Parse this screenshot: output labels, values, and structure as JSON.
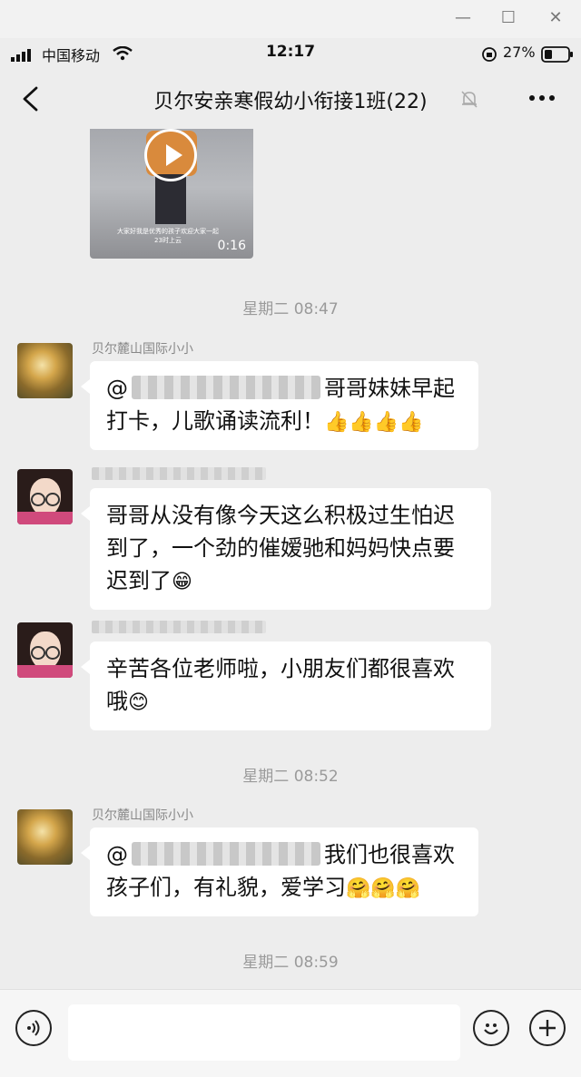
{
  "window": {
    "minimize": "—",
    "maximize": "☐",
    "close": "✕"
  },
  "status_bar": {
    "carrier": "中国移动",
    "time": "12:17",
    "battery": "27%"
  },
  "nav": {
    "title": "贝尔安亲寒假幼小衔接1班(22)"
  },
  "video": {
    "caption": "大家好我是优秀的孩子欢迎大家一起 23时上云",
    "duration": "0:16"
  },
  "timestamps": [
    "星期二 08:47",
    "星期二 08:52",
    "星期二 08:59"
  ],
  "messages": [
    {
      "sender": "贝尔麓山国际小小",
      "text_a": "@",
      "text_b": "哥哥妹妹早起",
      "text_c": "打卡，儿歌诵读流利！",
      "emoji": "👍👍👍👍"
    },
    {
      "sender": "",
      "text_a": "哥哥从没有像今天这么积极过生怕迟",
      "text_b": "到了，一个劲的催嫒驰和妈妈快点要",
      "text_c": "迟到了",
      "emoji": "😁"
    },
    {
      "sender": "",
      "text_a": "辛苦各位老师啦，小朋友们都很喜欢",
      "text_b": "哦",
      "emoji": "😊"
    },
    {
      "sender": "贝尔麓山国际小小",
      "text_a": "@",
      "text_b": "我们也很喜欢",
      "text_c": "孩子们，有礼貌，爱学习",
      "emoji": "🤗🤗🤗"
    }
  ],
  "input": {
    "value": ""
  },
  "icons": {
    "back": "chevron-left-icon",
    "mute": "bell-off-icon",
    "more": "more-icon",
    "voice": "voice-icon",
    "emoji": "emoji-icon",
    "plus": "plus-icon"
  }
}
